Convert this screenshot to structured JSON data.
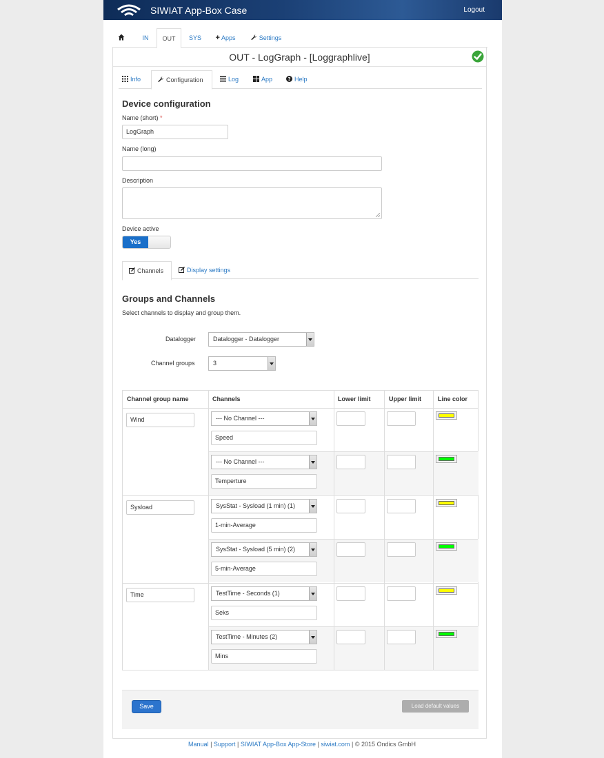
{
  "header": {
    "title": "SIWIAT App-Box Case",
    "logout": "Logout"
  },
  "top_tabs": [
    {
      "label": ""
    },
    {
      "label": "IN"
    },
    {
      "label": "OUT"
    },
    {
      "label": "SYS"
    },
    {
      "label": "Apps"
    },
    {
      "label": "Settings"
    }
  ],
  "panel": {
    "title": "OUT - LogGraph - [Loggraphlive]"
  },
  "sub_tabs": [
    {
      "label": "Info"
    },
    {
      "label": "Configuration"
    },
    {
      "label": "Log"
    },
    {
      "label": "App"
    },
    {
      "label": "Help"
    }
  ],
  "device_config": {
    "heading": "Device configuration",
    "name_short_label": "Name (short)",
    "required_marker": "*",
    "name_short_value": "LogGraph",
    "name_long_label": "Name (long)",
    "name_long_value": "",
    "description_label": "Description",
    "device_active_label": "Device active",
    "device_active_value": "Yes"
  },
  "channel_tabs": [
    {
      "label": "Channels"
    },
    {
      "label": "Display settings"
    }
  ],
  "groups": {
    "heading": "Groups and Channels",
    "help": "Select channels to display and group them.",
    "datalogger_label": "Datalogger",
    "datalogger_value": "Datalogger - Datalogger",
    "channel_groups_label": "Channel groups",
    "channel_groups_value": "3"
  },
  "table": {
    "headers": [
      "Channel group name",
      "Channels",
      "Lower limit",
      "Upper limit",
      "Line color"
    ],
    "groups": [
      {
        "name": "Wind",
        "channels": [
          {
            "select": "--- No Channel ---",
            "label": "Speed",
            "lower": "",
            "upper": "",
            "color": "#ffff00"
          },
          {
            "select": "--- No Channel ---",
            "label": "Temperture",
            "lower": "",
            "upper": "",
            "color": "#00ff00"
          }
        ]
      },
      {
        "name": "Sysload",
        "channels": [
          {
            "select": "SysStat - Sysload (1 min) (1)",
            "label": "1-min-Average",
            "lower": "",
            "upper": "",
            "color": "#ffff00"
          },
          {
            "select": "SysStat - Sysload (5 min) (2)",
            "label": "5-min-Average",
            "lower": "",
            "upper": "",
            "color": "#00ff00"
          }
        ]
      },
      {
        "name": "Time",
        "channels": [
          {
            "select": "TestTime - Seconds (1)",
            "label": "Seks",
            "lower": "",
            "upper": "",
            "color": "#ffff00"
          },
          {
            "select": "TestTime - Minutes (2)",
            "label": "Mins",
            "lower": "",
            "upper": "",
            "color": "#00ff00"
          }
        ]
      }
    ]
  },
  "actions": {
    "save": "Save",
    "load_defaults": "Load default values"
  },
  "footer": {
    "links": [
      "Manual",
      "Support",
      "SIWIAT App-Box App-Store",
      "siwiat.com"
    ],
    "separator": "|",
    "copyright": "© 2015 Ondics GmbH"
  }
}
